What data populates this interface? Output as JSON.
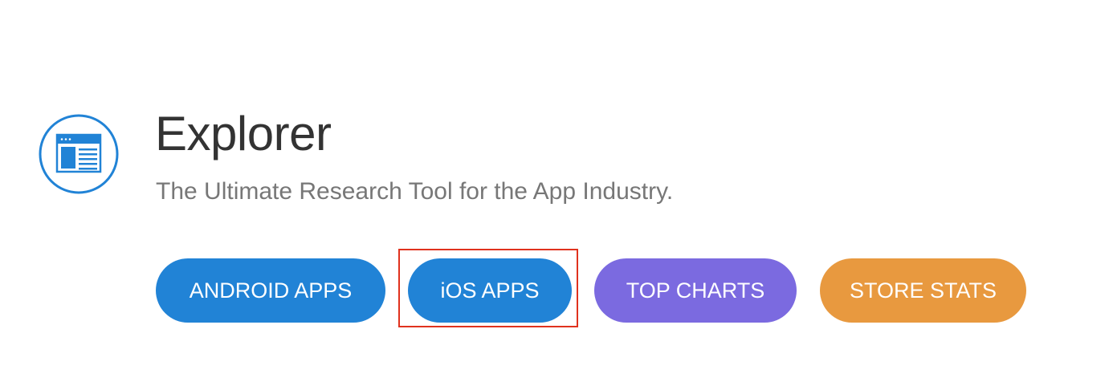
{
  "header": {
    "title": "Explorer",
    "subtitle": "The Ultimate Research Tool for the App Industry."
  },
  "logo": {
    "icon": "browser-window-icon",
    "color": "#2183d6"
  },
  "buttons": [
    {
      "label": "ANDROID APPS",
      "color": "#2183d6"
    },
    {
      "label": "iOS APPS",
      "color": "#2183d6"
    },
    {
      "label": "TOP CHARTS",
      "color": "#7b6ae0"
    },
    {
      "label": "STORE STATS",
      "color": "#e8993f"
    }
  ],
  "highlight": {
    "target": "iOS APPS",
    "color": "#e0321e"
  }
}
